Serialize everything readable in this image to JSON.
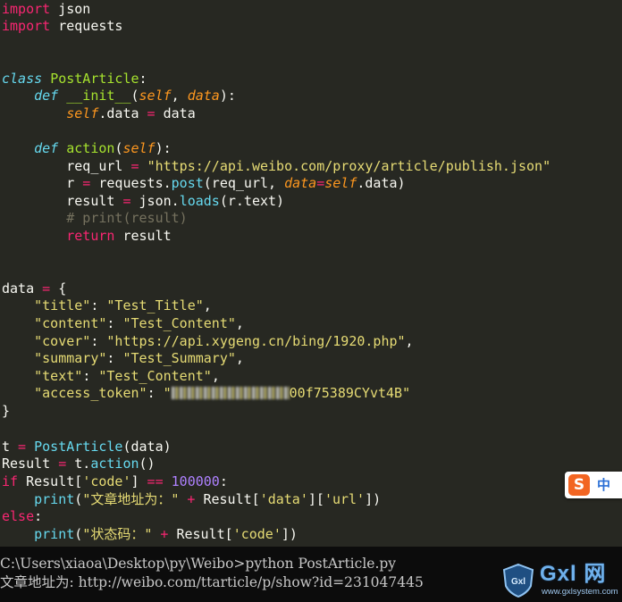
{
  "editor": {
    "code": {
      "import_kw": "import",
      "mod_json": "json",
      "mod_requests": "requests",
      "class_kw": "class",
      "class_name": "PostArticle",
      "def_kw": "def",
      "init_name": "__init__",
      "self_param": "self",
      "data_param": "data",
      "attr_data": ".data",
      "eq": " = ",
      "action_name": "action",
      "req_url_var": "req_url",
      "api_url": "\"https://api.weibo.com/proxy/article/publish.json\"",
      "r_var": "r",
      "requests_mod": "requests.",
      "post_call": "post",
      "post_args_open": "(req_url, ",
      "kwarg_data": "data",
      "kwarg_eq": "=",
      "post_args_close": ".data)",
      "result_var": "result",
      "json_dot": "json.",
      "loads_call": "loads",
      "loads_args": "(r.text)",
      "comment_print": "# print(result)",
      "return_kw": "return",
      "return_val": " result",
      "data_var": "data",
      "dict_open": "{",
      "dict_close": "}",
      "key_title": "\"title\"",
      "val_title": "\"Test_Title\"",
      "key_content": "\"content\"",
      "val_content": "\"Test_Content\"",
      "key_cover": "\"cover\"",
      "val_cover": "\"https://api.xygeng.cn/bing/1920.php\"",
      "key_summary": "\"summary\"",
      "val_summary": "\"Test_Summary\"",
      "key_text": "\"text\"",
      "val_text": "\"Test_Content\"",
      "key_token": "\"access_token\"",
      "token_open": "\"",
      "token_visible": "00f75389CYvt4B\"",
      "t_var": "t",
      "postarticle_call": "PostArticle",
      "postarticle_args": "(data)",
      "Result_var": "Result",
      "t_dot": "t.",
      "action_call": "action",
      "empty_args": "()",
      "if_kw": "if",
      "result_index_open": " Result[",
      "key_code": "'code'",
      "index_close": "]",
      "eqeq": " == ",
      "num_100000": "100000",
      "colon": ":",
      "print_call": "print",
      "str_article_addr": "\"文章地址为：\"",
      "plus": " + ",
      "result_data_url_open": "Result[",
      "key_data": "'data'",
      "key_url": "'url'",
      "else_kw": "else",
      "str_status": "\"状态码：\""
    }
  },
  "terminal": {
    "prompt_line": "C:\\Users\\xiaoa\\Desktop\\py\\Weibo>python PostArticle.py",
    "output_line": "文章地址为: http://weibo.com/ttarticle/p/show?id=231047445"
  },
  "ime": {
    "logo_glyph": "S",
    "lang": "中"
  },
  "watermark": {
    "brand": "Gxl 网",
    "site": "www.gxlsystem.com",
    "shield_text": "Gxl"
  },
  "colors": {
    "editor_bg": "#272822",
    "keyword": "#f92672",
    "storage": "#66d9ef",
    "function": "#a6e22e",
    "parameter": "#fd971f",
    "string": "#e6db74",
    "number": "#ae81ff",
    "comment": "#75715e",
    "terminal_bg": "#0c0c0c",
    "ime_brand": "#f26522"
  }
}
